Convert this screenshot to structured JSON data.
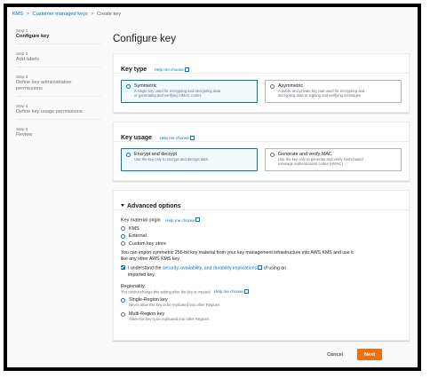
{
  "breadcrumb": {
    "items": [
      "KMS",
      "Customer managed keys",
      "Create key"
    ],
    "separator": ">"
  },
  "sidebar": {
    "steps": [
      {
        "num": "Step 1",
        "label": "Configure key"
      },
      {
        "num": "Step 2",
        "label": "Add labels"
      },
      {
        "num": "Step 3",
        "label": "Define key administrative permissions"
      },
      {
        "num": "Step 4",
        "label": "Define key usage permissions"
      },
      {
        "num": "Step 5",
        "label": "Review"
      }
    ]
  },
  "page": {
    "title": "Configure key"
  },
  "help_link": "Help me choose",
  "key_type": {
    "title": "Key type",
    "options": [
      {
        "title": "Symmetric",
        "desc1": "A single key used for encrypting and decrypting data",
        "desc2": "or generating and verifying HMAC codes",
        "selected": true
      },
      {
        "title": "Asymmetric",
        "desc1": "A public and private key pair used for encrypting and",
        "desc2": "decrypting data or signing and verifying messages",
        "selected": false
      }
    ]
  },
  "key_usage": {
    "title": "Key usage",
    "options": [
      {
        "title": "Encrypt and decrypt",
        "desc1": "Use the key only to encrypt and decrypt data.",
        "desc2": "",
        "selected": true
      },
      {
        "title": "Generate and verify MAC",
        "desc1": "Use the key only to generate and verify hash-based",
        "desc2": "message authentication codes (HMAC)",
        "selected": false
      }
    ]
  },
  "advanced": {
    "title": "Advanced options",
    "key_material_label": "Key material origin",
    "origins": [
      {
        "label": "KMS",
        "selected": false
      },
      {
        "label": "External",
        "selected": true
      },
      {
        "label": "Custom key store",
        "selected": false
      }
    ],
    "import_text_1": "You can import symmetric 256-bit key material from your key management infrastructure into AWS KMS and use it",
    "import_text_2": "like any other AWS KMS key.",
    "ack_prefix": "I understand the ",
    "ack_link": "security, availability, and durability implications",
    "ack_suffix": " of using an",
    "ack_line2": "imported key.",
    "regionality_label": "Regionality",
    "regionality_sub": "You cannot change this setting after the key is created.",
    "regions": [
      {
        "label": "Single-Region key",
        "desc": "Never allow this key to be replicated into other Regions",
        "selected": true
      },
      {
        "label": "Multi-Region key",
        "desc": "Allow this key to be replicated into other Regions",
        "selected": false
      }
    ]
  },
  "footer": {
    "cancel": "Cancel",
    "next": "Next"
  }
}
